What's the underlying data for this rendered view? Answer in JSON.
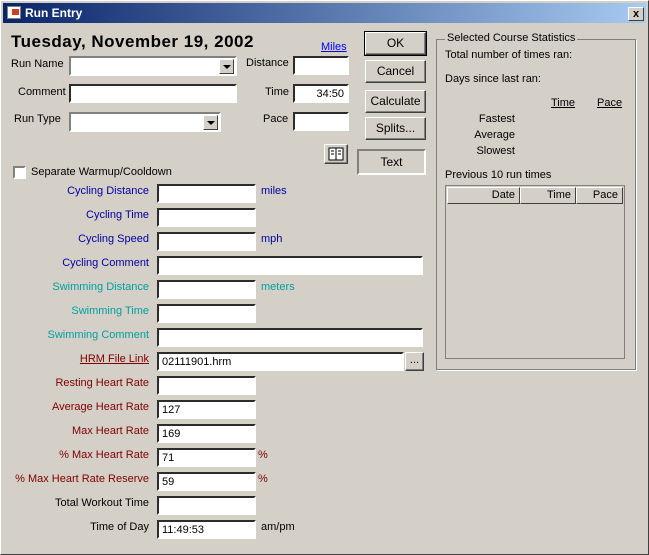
{
  "window": {
    "title": "Run Entry",
    "close_label": "x"
  },
  "date_heading": "Tuesday, November 19, 2002",
  "units_link": "Miles",
  "fields": {
    "run_name": {
      "label": "Run Name",
      "value": ""
    },
    "comment": {
      "label": "Comment",
      "value": ""
    },
    "run_type": {
      "label": "Run Type",
      "value": ""
    },
    "distance": {
      "label": "Distance",
      "value": ""
    },
    "time": {
      "label": "Time",
      "value": "34:50"
    },
    "pace": {
      "label": "Pace",
      "value": ""
    }
  },
  "buttons": {
    "ok": "OK",
    "cancel": "Cancel",
    "calculate": "Calculate",
    "splits": "Splits...",
    "text": "Text",
    "browse": "..."
  },
  "separate_warmup": {
    "label": "Separate Warmup/Cooldown",
    "checked": false
  },
  "extra_fields": [
    {
      "label": "Cycling Distance",
      "value": "",
      "unit": "miles"
    },
    {
      "label": "Cycling Time",
      "value": "",
      "unit": ""
    },
    {
      "label": "Cycling Speed",
      "value": "",
      "unit": "mph"
    },
    {
      "label": "Cycling Comment",
      "value": "",
      "unit": ""
    },
    {
      "label": "Swimming Distance",
      "value": "",
      "unit": "meters"
    },
    {
      "label": "Swimming Time",
      "value": "",
      "unit": ""
    },
    {
      "label": "Swimming Comment",
      "value": "",
      "unit": ""
    },
    {
      "label": "HRM File Link",
      "value": "02111901.hrm",
      "unit": ""
    },
    {
      "label": "Resting Heart Rate",
      "value": "",
      "unit": ""
    },
    {
      "label": "Average Heart Rate",
      "value": "127",
      "unit": ""
    },
    {
      "label": "Max Heart Rate",
      "value": "169",
      "unit": ""
    },
    {
      "label": "% Max Heart Rate",
      "value": "71",
      "unit": "%"
    },
    {
      "label": "% Max Heart Rate Reserve",
      "value": "59",
      "unit": "%"
    },
    {
      "label": "Total Workout Time",
      "value": "",
      "unit": ""
    },
    {
      "label": "Time of Day",
      "value": "11:49:53",
      "unit": "am/pm"
    }
  ],
  "stats": {
    "group_title": "Selected Course Statistics",
    "times_ran_label": "Total number of times ran:",
    "days_since_label": "Days since last ran:",
    "col_time": "Time",
    "col_pace": "Pace",
    "fastest": "Fastest",
    "average": "Average",
    "slowest": "Slowest",
    "previous_label": "Previous 10 run times",
    "list_headers": [
      "Date",
      "Time",
      "Pace"
    ]
  },
  "colors": {
    "cycling": "#0000a0",
    "swimming": "#00a0a0",
    "heart": "#800000",
    "link": "#0000ff"
  }
}
